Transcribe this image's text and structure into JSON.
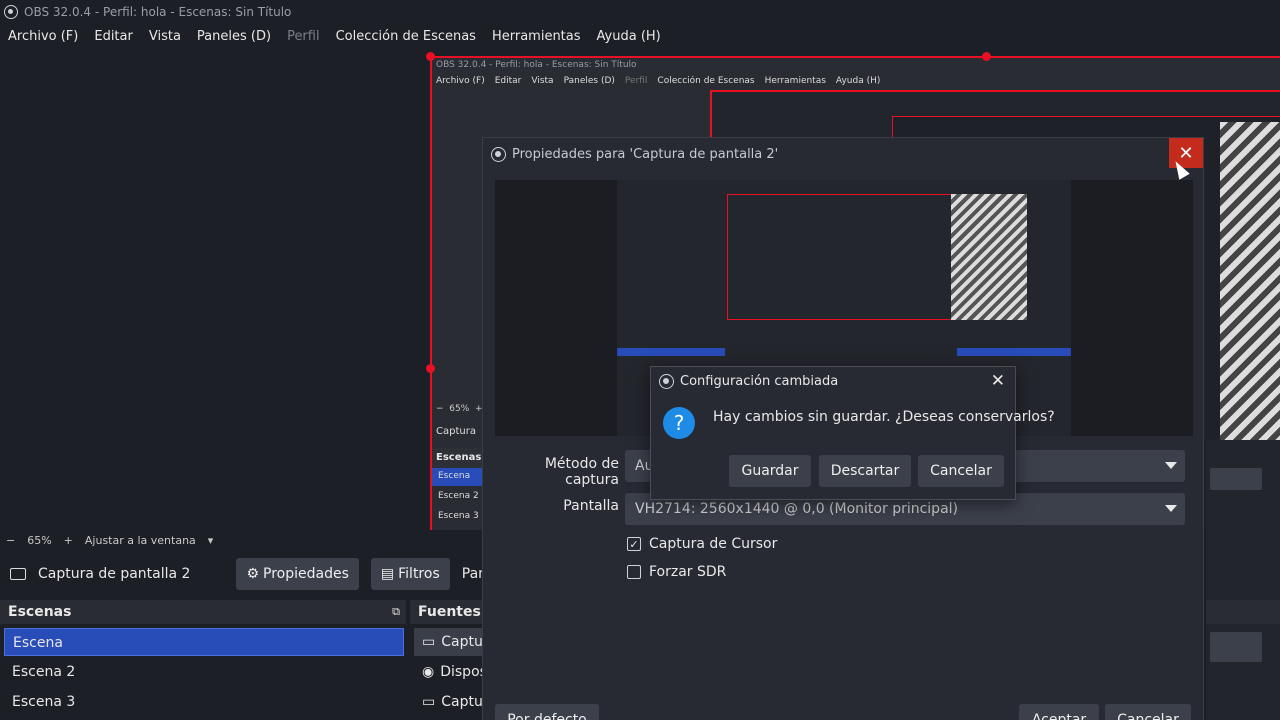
{
  "window": {
    "title": "OBS 32.0.4 - Perfil: hola - Escenas: Sin Título"
  },
  "menu": {
    "items": [
      "Archivo (F)",
      "Editar",
      "Vista",
      "Paneles (D)",
      "Perfil",
      "Colección de Escenas",
      "Herramientas",
      "Ayuda (H)"
    ]
  },
  "nested_preview": {
    "title": "OBS 32.0.4 - Perfil: hola - Escenas: Sin Título",
    "menu": [
      "Archivo (F)",
      "Editar",
      "Vista",
      "Paneles (D)",
      "Perfil",
      "Colección de Escenas",
      "Herramientas",
      "Ayuda (H)"
    ],
    "zoom": "65%",
    "source": "Captura",
    "scenes_header": "Escenas",
    "scenes": [
      "Escena",
      "Escena 2",
      "Escena 3"
    ]
  },
  "zoombar": {
    "minus": "−",
    "zoom": "65%",
    "plus": "+",
    "fit": "Ajustar a la ventana"
  },
  "sourcebar": {
    "source_name": "Captura de pantalla 2",
    "properties_label": "Propiedades",
    "filters_label": "Filtros",
    "truncated_label": "Pantalla"
  },
  "scenes_dock": {
    "title": "Escenas",
    "items": [
      "Escena",
      "Escena 2",
      "Escena 3"
    ]
  },
  "sources_dock": {
    "title": "Fuentes",
    "items": [
      "Captu",
      "Dispos",
      "Captu"
    ]
  },
  "properties_dialog": {
    "title": "Propiedades para 'Captura de pantalla 2'",
    "close": "✕",
    "capture_method_label": "Método de captura",
    "capture_method_value": "Au",
    "display_label": "Pantalla",
    "display_value": "VH2714: 2560x1440 @ 0,0 (Monitor principal)",
    "cursor_checkbox": "Captura de Cursor",
    "cursor_checked": true,
    "sdr_checkbox": "Forzar SDR",
    "sdr_checked": false,
    "defaults_button": "Por defecto",
    "accept_button": "Aceptar",
    "cancel_button": "Cancelar"
  },
  "confirm_dialog": {
    "title": "Configuración cambiada",
    "close": "✕",
    "icon": "?",
    "message": "Hay cambios sin guardar. ¿Deseas conservarlos?",
    "save_button": "Guardar",
    "discard_button": "Descartar",
    "cancel_button": "Cancelar"
  },
  "colors": {
    "selection": "#284cb8",
    "bounding_box": "#e81123",
    "background": "#1d1f26",
    "button": "#3c404b",
    "question_icon": "#1e8be6"
  }
}
